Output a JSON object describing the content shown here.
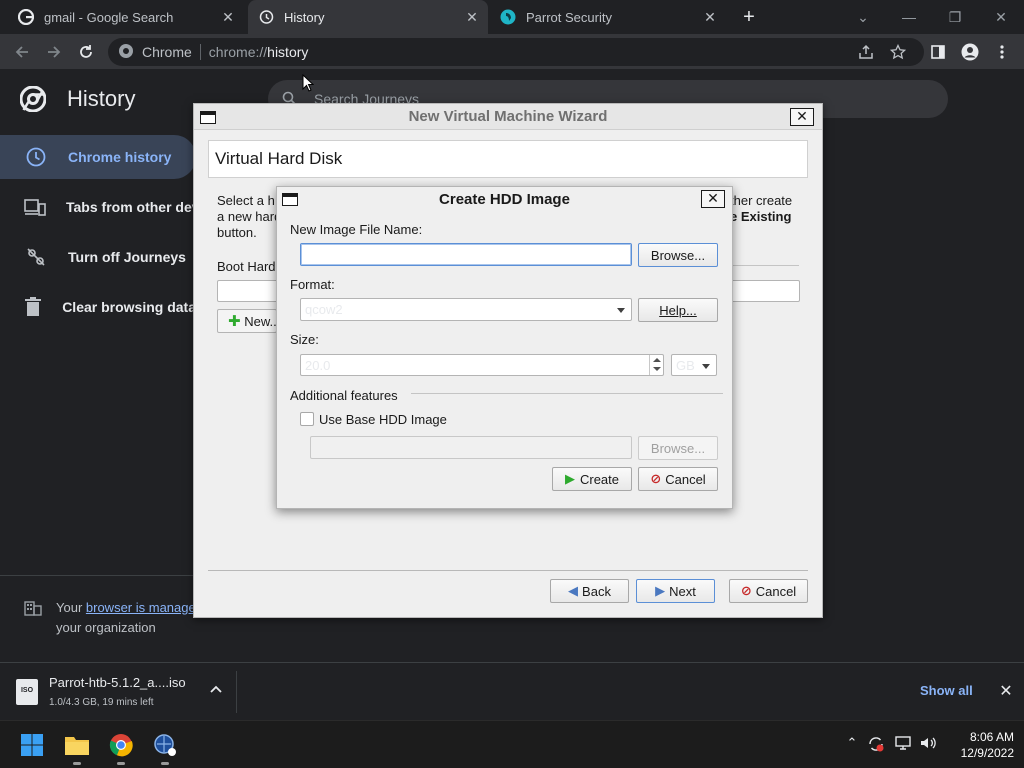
{
  "tabs": [
    {
      "title": "gmail - Google Search",
      "icon": "google-icon",
      "active": false
    },
    {
      "title": "History",
      "icon": "history-icon",
      "active": true
    },
    {
      "title": "Parrot Security",
      "icon": "parrot-icon",
      "active": false
    }
  ],
  "toolbar": {
    "chip_label": "Chrome",
    "url_scheme": "chrome://",
    "url_host": "history"
  },
  "history_page": {
    "title": "History",
    "search_placeholder": "Search Journeys",
    "sidebar": [
      {
        "label": "Chrome history",
        "icon": "clock-icon",
        "selected": true
      },
      {
        "label": "Tabs from other devices",
        "icon": "devices-icon",
        "selected": false
      },
      {
        "label": "Turn off Journeys",
        "icon": "journeys-off-icon",
        "selected": false
      },
      {
        "label": "Clear browsing data",
        "icon": "trash-icon",
        "selected": false
      }
    ],
    "managed_prefix": "Your ",
    "managed_link": "browser is managed",
    "managed_suffix": "your organization"
  },
  "download_shelf": {
    "file_name": "Parrot-htb-5.1.2_a....iso",
    "file_icon_text": "ISO",
    "status": "1.0/4.3 GB, 19 mins left",
    "show_all": "Show all"
  },
  "taskbar": {
    "time": "8:06 AM",
    "date": "12/9/2022"
  },
  "wizard": {
    "title": "New Virtual Machine Wizard",
    "page_title": "Virtual Hard Disk",
    "desc_left_1": "Select a h",
    "desc_left_2": "a new hard",
    "desc_left_3": "button.",
    "desc_right_1": "ther create",
    "desc_right_2": "e Existing",
    "boot_label": "Boot Hard",
    "new_button": "New...",
    "back_button": "Back",
    "next_button": "Next",
    "cancel_button": "Cancel"
  },
  "hdd_dialog": {
    "title": "Create HDD Image",
    "file_name_label": "New Image File Name:",
    "file_name_value": "",
    "browse_button": "Browse...",
    "format_label": "Format:",
    "format_value": "qcow2",
    "help_button": "Help...",
    "size_label": "Size:",
    "size_value": "20.0",
    "size_unit": "GB",
    "additional_label": "Additional features",
    "use_base_label": "Use Base HDD Image",
    "use_base_checked": false,
    "base_browse_button": "Browse...",
    "create_button": "Create",
    "cancel_button": "Cancel"
  },
  "colors": {
    "chrome_dark": "#202124",
    "chrome_toolbar": "#35363a",
    "link_blue": "#8ab4f8",
    "selected_bg": "#394457",
    "dialog_bg": "#efefef"
  }
}
